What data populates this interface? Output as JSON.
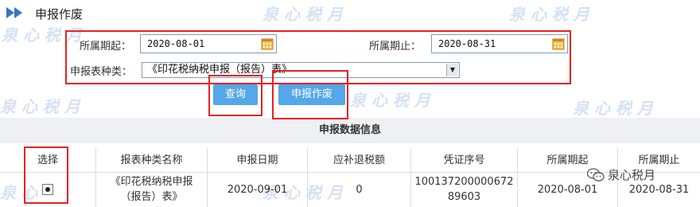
{
  "page": {
    "title": "申报作废"
  },
  "form": {
    "start_label": "所属期起：",
    "start_value": "2020-08-01",
    "end_label": "所属期止：",
    "end_value": "2020-08-31",
    "type_label": "申报表种类：",
    "type_value": "《印花税纳税申报（报告）表》"
  },
  "buttons": {
    "query": "查询",
    "void": "申报作废"
  },
  "info_title": "申报数据信息",
  "table": {
    "headers": [
      "选择",
      "报表种类名称",
      "申报日期",
      "应补退税额",
      "凭证序号",
      "所属期起",
      "所属期止"
    ],
    "row": {
      "name": "《印花税纳税申报（报告）表》",
      "date": "2020-09-01",
      "tax": "0",
      "voucher": "10013720000067289603",
      "start": "2020-08-01",
      "end": "2020-08-31"
    }
  },
  "watermark": {
    "text": "泉心税月",
    "wechat_label": "泉心税月"
  },
  "colors": {
    "button": "#54a7e8",
    "highlight": "#e52222",
    "header_arrow": "#3a72c4"
  }
}
